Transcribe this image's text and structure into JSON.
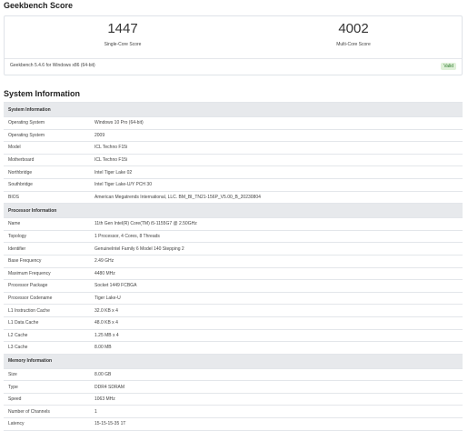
{
  "header": {
    "title": "Geekbench Score"
  },
  "scores": {
    "single": {
      "value": "1447",
      "label": "Single-Core Score"
    },
    "multi": {
      "value": "4002",
      "label": "Multi-Core Score"
    },
    "version": "Geekbench 5.4.6 for Windows x86 (64-bit)",
    "status": "Valid"
  },
  "system_section_title": "System Information",
  "sections": [
    {
      "title": "System Information",
      "rows": [
        [
          "Operating System",
          "Windows 10 Pro (64-bit)"
        ],
        [
          "Operating System",
          "2009"
        ],
        [
          "Model",
          "ICL Techno F15i"
        ],
        [
          "Motherboard",
          "ICL Techno F15i"
        ],
        [
          "Northbridge",
          "Intel Tiger Lake 02"
        ],
        [
          "Southbridge",
          "Intel Tiger Lake-U/Y PCH 30"
        ],
        [
          "BIOS",
          "American Megatrends International, LLC. BM_BI_TN21-156P_V5.00_B_20230804"
        ]
      ]
    },
    {
      "title": "Processor Information",
      "rows": [
        [
          "Name",
          "11th Gen Intel(R) Core(TM) i5-1155G7 @ 2.50GHz"
        ],
        [
          "Topology",
          "1 Processor, 4 Cores, 8 Threads"
        ],
        [
          "Identifier",
          "GenuineIntel Family 6 Model 140 Stepping 2"
        ],
        [
          "Base Frequency",
          "2.49 GHz"
        ],
        [
          "Maximum Frequency",
          "4480 MHz"
        ],
        [
          "Processor Package",
          "Socket 1449 FCBGA"
        ],
        [
          "Processor Codename",
          "Tiger Lake-U"
        ],
        [
          "L1 Instruction Cache",
          "32.0 KB x 4"
        ],
        [
          "L1 Data Cache",
          "48.0 KB x 4"
        ],
        [
          "L2 Cache",
          "1.25 MB x 4"
        ],
        [
          "L3 Cache",
          "8.00 MB"
        ]
      ]
    },
    {
      "title": "Memory Information",
      "rows": [
        [
          "Size",
          "8.00 GB"
        ],
        [
          "Type",
          "DDR4 SDRAM"
        ],
        [
          "Speed",
          "1063 MHz"
        ],
        [
          "Number of Channels",
          "1"
        ],
        [
          "Latency",
          "15-15-15-35 1T"
        ]
      ]
    }
  ],
  "colors": {
    "section_bg": "#e7e9ec",
    "valid_bg": "#dff0d8",
    "valid_text": "#2b7a2b"
  }
}
